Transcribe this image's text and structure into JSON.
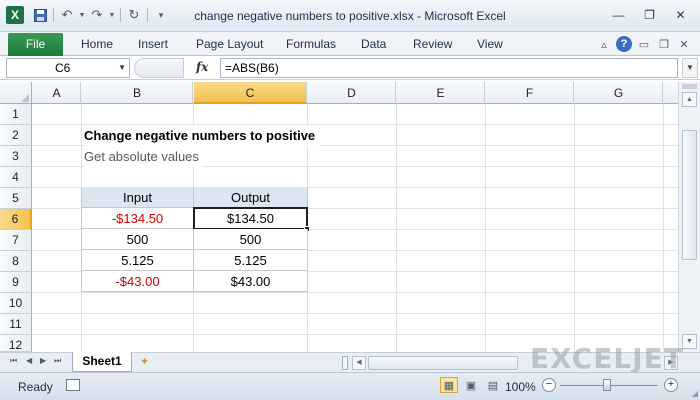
{
  "window": {
    "title": "change negative numbers to positive.xlsx  -  Microsoft Excel",
    "app_icon": "X",
    "min_glyph": "—",
    "restore_glyph": "❐",
    "close_glyph": "✕"
  },
  "qat": {
    "save_icon": "save-icon",
    "undo_icon": "undo-icon",
    "redo_icon": "redo-icon",
    "refresh_icon": "refresh-icon",
    "customize_icon": "customize-icon"
  },
  "ribbon": {
    "file_tab": "File",
    "tabs": [
      "Home",
      "Insert",
      "Page Layout",
      "Formulas",
      "Data",
      "Review",
      "View"
    ],
    "help": "?"
  },
  "formula_bar": {
    "name_box": "C6",
    "fx_label": "fx",
    "formula": "=ABS(B6)"
  },
  "grid": {
    "columns": [
      "A",
      "B",
      "C",
      "D",
      "E",
      "F",
      "G"
    ],
    "active_column": "C",
    "rows": [
      "1",
      "2",
      "3",
      "4",
      "5",
      "6",
      "7",
      "8",
      "9",
      "10",
      "11",
      "12"
    ],
    "active_row": "6"
  },
  "sheet": {
    "title": "Change negative numbers to positive",
    "subtitle": "Get absolute values",
    "table_headers": [
      "Input",
      "Output"
    ],
    "table_rows": [
      {
        "input": "-$134.50",
        "output": "$134.50",
        "input_negative": true
      },
      {
        "input": "500",
        "output": "500",
        "input_negative": false
      },
      {
        "input": "5.125",
        "output": "5.125",
        "input_negative": false
      },
      {
        "input": "-$43.00",
        "output": "$43.00",
        "input_negative": true
      }
    ],
    "selected_cell": "C6"
  },
  "sheet_tabs": {
    "tabs": [
      "Sheet1"
    ],
    "active": "Sheet1"
  },
  "watermark": "EXCELJET",
  "status": {
    "ready": "Ready",
    "zoom": "100%"
  },
  "colors": {
    "file_tab": "#1e7b3a",
    "header_fill": "#dce6f1",
    "negative": "#d10000",
    "active_header": "#f2c14f"
  }
}
